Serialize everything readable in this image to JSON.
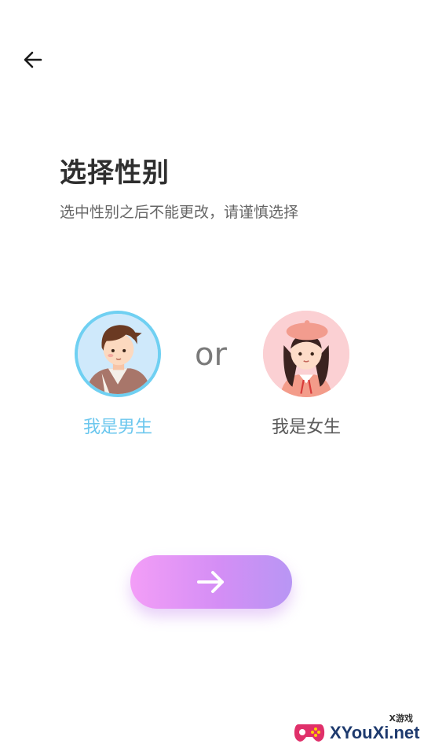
{
  "title": "选择性别",
  "subtitle": "选中性别之后不能更改，请谨慎选择",
  "options": {
    "male": {
      "label": "我是男生",
      "selected": true
    },
    "female": {
      "label": "我是女生",
      "selected": false
    }
  },
  "or_text": "or",
  "icons": {
    "back": "arrow-left-icon",
    "next": "arrow-right-icon"
  },
  "colors": {
    "selected_accent": "#6fd0f2",
    "button_gradient_start": "#f39ef7",
    "button_gradient_end": "#b896f4"
  },
  "watermark": {
    "top_text": "X游戏",
    "main_text": "XYouXi.net"
  }
}
